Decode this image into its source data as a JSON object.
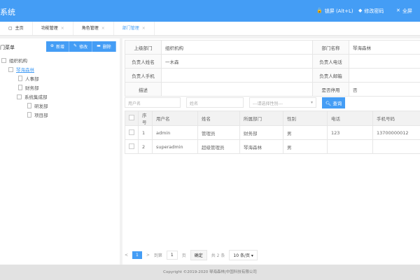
{
  "header": {
    "title": "系统",
    "lock": "锁屏 (Alt+L)",
    "change_password": "修改密码",
    "fullscreen": "全屏"
  },
  "tabs": [
    {
      "label": "主页"
    },
    {
      "label": "功能管理"
    },
    {
      "label": "角色管理"
    },
    {
      "label": "部门管理",
      "active": true
    }
  ],
  "left": {
    "title": "门菜单",
    "add": "新增",
    "edit": "修改",
    "delete": "删除",
    "tree": [
      "组织机构",
      "琴海森林",
      "人事部",
      "财务部",
      "系统集成部",
      "研发部",
      "项目部"
    ]
  },
  "form": {
    "parent_label": "上级部门",
    "parent": "组织机构",
    "name_label": "部门名称",
    "name": "琴海森林",
    "leader_label": "负责人姓名",
    "leader": "一木森",
    "phone_label": "负责人电话",
    "phone": "",
    "mobile_label": "负责人手机",
    "mobile": "",
    "email_label": "负责人邮箱",
    "email": "",
    "desc_label": "描述",
    "desc": "",
    "disabled_label": "是否停用",
    "disabled": "否"
  },
  "search": {
    "username_ph": "用户名",
    "name_ph": "姓名",
    "gender_ph": "---请选择性别---",
    "query": "查询"
  },
  "table": {
    "headers": [
      "序号",
      "用户名",
      "姓名",
      "所属部门",
      "性别",
      "电话",
      "手机号码"
    ],
    "rows": [
      [
        "1",
        "admin",
        "管理员",
        "财务部",
        "男",
        "123",
        "13700000012"
      ],
      [
        "2",
        "superadmin",
        "超级管理员",
        "琴海森林",
        "男",
        "",
        ""
      ]
    ]
  },
  "pagination": {
    "page": "1",
    "goto": "到第",
    "input": "1",
    "page_unit": "页",
    "confirm": "确定",
    "total": "共 2 条",
    "per_page": "10 条/页"
  },
  "footer": "Copyright ©2019-2020 琴海森林|中国科技有限公司",
  "colors": {
    "primary": "#449df5"
  }
}
